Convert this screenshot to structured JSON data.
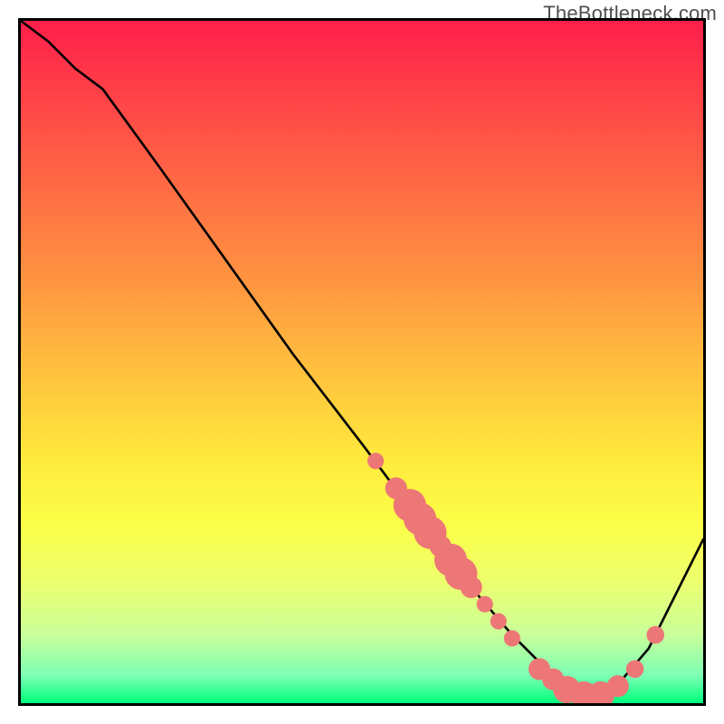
{
  "watermark": "TheBottleneck.com",
  "chart_data": {
    "type": "line",
    "title": "",
    "xlabel": "",
    "ylabel": "",
    "xlim": [
      0,
      100
    ],
    "ylim": [
      0,
      100
    ],
    "grid": false,
    "legend": false,
    "series": [
      {
        "name": "curve",
        "color": "#000000",
        "x": [
          0,
          4,
          8,
          12,
          20,
          30,
          40,
          50,
          56,
          60,
          66,
          72,
          78,
          82,
          86,
          92,
          100
        ],
        "y": [
          100,
          97,
          93,
          90,
          79,
          65,
          51,
          38,
          30,
          25,
          17,
          10,
          4,
          1,
          1,
          8,
          24
        ]
      }
    ],
    "markers": [
      {
        "x": 52.0,
        "y": 35.5,
        "r": 1.2
      },
      {
        "x": 55.0,
        "y": 31.5,
        "r": 1.6
      },
      {
        "x": 57.0,
        "y": 29.0,
        "r": 2.4
      },
      {
        "x": 58.5,
        "y": 27.0,
        "r": 2.4
      },
      {
        "x": 60.0,
        "y": 25.0,
        "r": 2.4
      },
      {
        "x": 61.5,
        "y": 23.0,
        "r": 1.6
      },
      {
        "x": 63.0,
        "y": 21.0,
        "r": 2.4
      },
      {
        "x": 64.5,
        "y": 19.0,
        "r": 2.4
      },
      {
        "x": 66.0,
        "y": 17.0,
        "r": 1.6
      },
      {
        "x": 68.0,
        "y": 14.5,
        "r": 1.2
      },
      {
        "x": 70.0,
        "y": 12.0,
        "r": 1.2
      },
      {
        "x": 72.0,
        "y": 9.5,
        "r": 1.2
      },
      {
        "x": 76.0,
        "y": 5.0,
        "r": 1.6
      },
      {
        "x": 78.0,
        "y": 3.5,
        "r": 1.6
      },
      {
        "x": 80.0,
        "y": 2.0,
        "r": 2.0
      },
      {
        "x": 82.5,
        "y": 1.2,
        "r": 2.0
      },
      {
        "x": 85.0,
        "y": 1.2,
        "r": 2.0
      },
      {
        "x": 87.5,
        "y": 2.5,
        "r": 1.6
      },
      {
        "x": 90.0,
        "y": 5.0,
        "r": 1.3
      },
      {
        "x": 93.0,
        "y": 10.0,
        "r": 1.3
      }
    ],
    "marker_color": "#ed7776",
    "gradient_stops": [
      {
        "pos": 0,
        "color": "#ff1f4a"
      },
      {
        "pos": 10,
        "color": "#ff3f48"
      },
      {
        "pos": 24,
        "color": "#ff6a45"
      },
      {
        "pos": 38,
        "color": "#ff9441"
      },
      {
        "pos": 52,
        "color": "#ffc33e"
      },
      {
        "pos": 64,
        "color": "#ffe93c"
      },
      {
        "pos": 74,
        "color": "#fbff48"
      },
      {
        "pos": 82,
        "color": "#eeff6e"
      },
      {
        "pos": 90,
        "color": "#c9ff9a"
      },
      {
        "pos": 96,
        "color": "#7cffb4"
      },
      {
        "pos": 100,
        "color": "#00ff7c"
      }
    ]
  }
}
